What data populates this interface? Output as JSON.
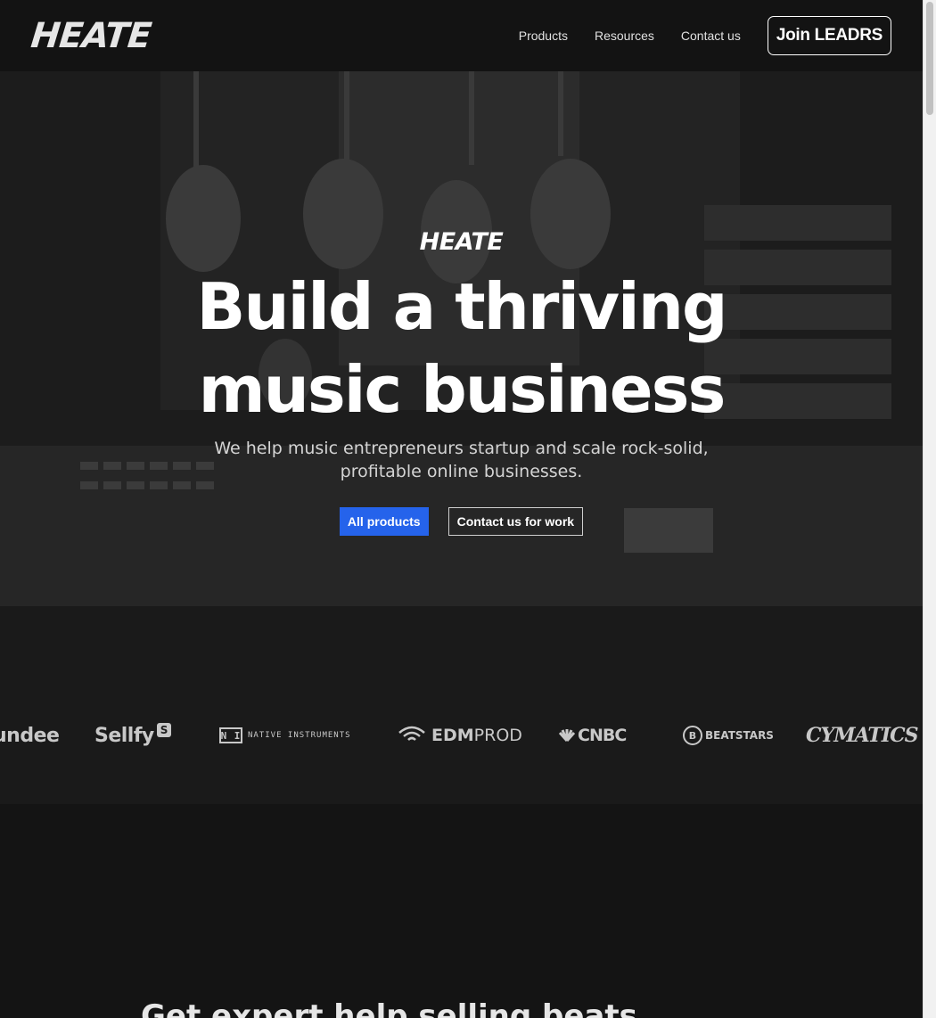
{
  "header": {
    "logo": "HEATE",
    "nav": [
      "Products",
      "Resources",
      "Contact us"
    ],
    "join_label": "Join LEADRS"
  },
  "hero": {
    "logo": "HEATE",
    "title": "Build a thriving music business",
    "subtitle": "We help music entrepreneurs startup and scale rock-solid, profitable online businesses.",
    "primary_button": "All products",
    "secondary_button": "Contact us for work"
  },
  "partners": {
    "p1": "undee",
    "p2": "Sellfy",
    "p2_badge": "S",
    "p3_mark": "N I",
    "p3": "NATIVE INSTRUMENTS",
    "p4_a": "EDM",
    "p4_b": "PROD",
    "p5": "CNBC",
    "p6_mark": "B",
    "p6": "BEATSTARS",
    "p7": "CYMATICS"
  },
  "section2": {
    "title": "Get expert help selling beats"
  },
  "colors": {
    "accent": "#2563eb",
    "background": "#141414"
  }
}
